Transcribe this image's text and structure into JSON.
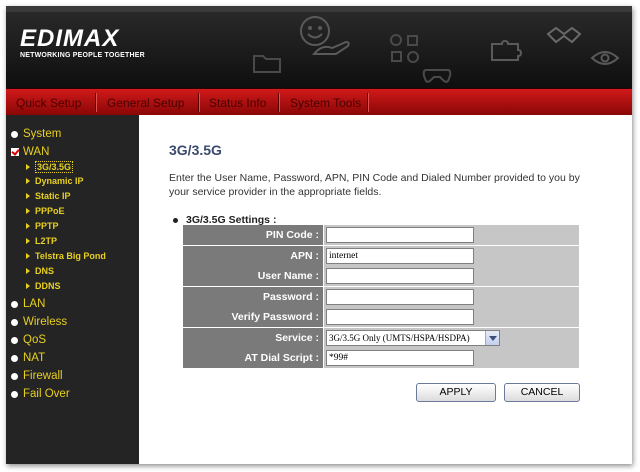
{
  "brand": {
    "logo": "EDIMAX",
    "tagline": "NETWORKING PEOPLE TOGETHER"
  },
  "nav": {
    "tabs": [
      {
        "label": "Quick Setup"
      },
      {
        "label": "General Setup"
      },
      {
        "label": "Status Info"
      },
      {
        "label": "System Tools"
      }
    ]
  },
  "sidebar": {
    "items": [
      {
        "label": "System"
      },
      {
        "label": "WAN"
      },
      {
        "label": "LAN"
      },
      {
        "label": "Wireless"
      },
      {
        "label": "QoS"
      },
      {
        "label": "NAT"
      },
      {
        "label": "Firewall"
      },
      {
        "label": "Fail Over"
      }
    ],
    "wan_sub": [
      {
        "label": "3G/3.5G"
      },
      {
        "label": "Dynamic IP"
      },
      {
        "label": "Static IP"
      },
      {
        "label": "PPPoE"
      },
      {
        "label": "PPTP"
      },
      {
        "label": "L2TP"
      },
      {
        "label": "Telstra Big Pond"
      },
      {
        "label": "DNS"
      },
      {
        "label": "DDNS"
      }
    ]
  },
  "main": {
    "title": "3G/3.5G",
    "description": "Enter the User Name, Password, APN, PIN Code and Dialed Number provided to you by your service provider in the appropriate fields.",
    "section": "3G/3.5G Settings :",
    "fields": {
      "pin_code": {
        "label": "PIN Code :",
        "value": ""
      },
      "apn": {
        "label": "APN :",
        "value": "internet"
      },
      "user_name": {
        "label": "User Name :",
        "value": ""
      },
      "password": {
        "label": "Password :",
        "value": ""
      },
      "verify_password": {
        "label": "Verify Password :",
        "value": ""
      },
      "service": {
        "label": "Service :",
        "value": "3G/3.5G Only (UMTS/HSPA/HSDPA)"
      },
      "at_dial_script": {
        "label": "AT Dial Script :",
        "value": "*99#"
      }
    },
    "apply_label": "APPLY",
    "cancel_label": "CANCEL"
  },
  "colors": {
    "nav_red": "#b01010",
    "sidebar_bg": "#242424",
    "sidebar_text": "#e8d020",
    "title_blue": "#3a4a6e"
  }
}
